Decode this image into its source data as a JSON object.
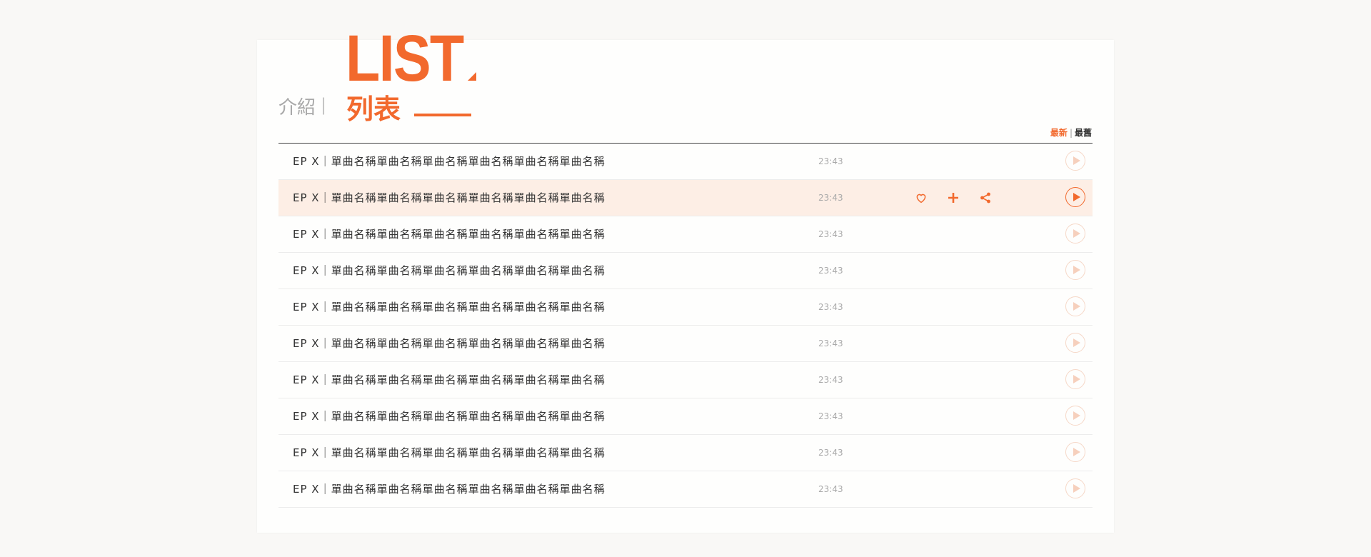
{
  "header": {
    "tab_intro": "介紹",
    "tab_separator": "|",
    "list_title_en": "LIST",
    "tab_list": "列表"
  },
  "sort": {
    "newest": "最新",
    "separator": "|",
    "oldest": "最舊"
  },
  "colors": {
    "accent": "#f2692d",
    "active_row_bg": "#fdeee5"
  },
  "tracks": [
    {
      "title": "EP X｜單曲名稱單曲名稱單曲名稱單曲名稱單曲名稱單曲名稱",
      "duration": "23:43"
    },
    {
      "title": "EP X｜單曲名稱單曲名稱單曲名稱單曲名稱單曲名稱單曲名稱",
      "duration": "23:43",
      "active": true
    },
    {
      "title": "EP X｜單曲名稱單曲名稱單曲名稱單曲名稱單曲名稱單曲名稱",
      "duration": "23:43"
    },
    {
      "title": "EP X｜單曲名稱單曲名稱單曲名稱單曲名稱單曲名稱單曲名稱",
      "duration": "23:43"
    },
    {
      "title": "EP X｜單曲名稱單曲名稱單曲名稱單曲名稱單曲名稱單曲名稱",
      "duration": "23:43"
    },
    {
      "title": "EP X｜單曲名稱單曲名稱單曲名稱單曲名稱單曲名稱單曲名稱",
      "duration": "23:43"
    },
    {
      "title": "EP X｜單曲名稱單曲名稱單曲名稱單曲名稱單曲名稱單曲名稱",
      "duration": "23:43"
    },
    {
      "title": "EP X｜單曲名稱單曲名稱單曲名稱單曲名稱單曲名稱單曲名稱",
      "duration": "23:43"
    },
    {
      "title": "EP X｜單曲名稱單曲名稱單曲名稱單曲名稱單曲名稱單曲名稱",
      "duration": "23:43"
    },
    {
      "title": "EP X｜單曲名稱單曲名稱單曲名稱單曲名稱單曲名稱單曲名稱",
      "duration": "23:43"
    }
  ],
  "row_icons": [
    "heart-icon",
    "plus-icon",
    "share-icon",
    "play-icon"
  ]
}
